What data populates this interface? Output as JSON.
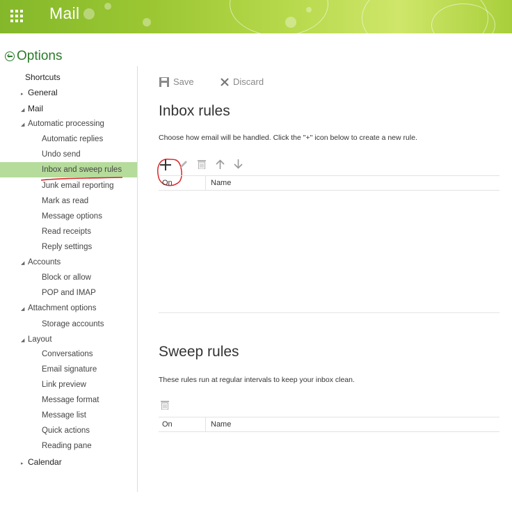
{
  "header": {
    "app_title": "Mail",
    "waffle_icon": "app-launcher-icon",
    "accent_color": "#8fbf2f"
  },
  "options": {
    "title": "Options",
    "back_icon": "back-arrow-circle-icon",
    "title_color": "#2a7a2a"
  },
  "nav": {
    "selected_color": "#b6dc9c",
    "items": [
      {
        "label": "Shortcuts",
        "type": "section",
        "arrow": ""
      },
      {
        "label": "General",
        "type": "section",
        "arrow": "collapsed"
      },
      {
        "label": "Mail",
        "type": "section",
        "arrow": "expanded"
      },
      {
        "label": "Automatic processing",
        "type": "group",
        "arrow": "expanded"
      },
      {
        "label": "Automatic replies",
        "type": "item"
      },
      {
        "label": "Undo send",
        "type": "item"
      },
      {
        "label": "Inbox and sweep rules",
        "type": "item",
        "selected": true
      },
      {
        "label": "Junk email reporting",
        "type": "item"
      },
      {
        "label": "Mark as read",
        "type": "item"
      },
      {
        "label": "Message options",
        "type": "item"
      },
      {
        "label": "Read receipts",
        "type": "item"
      },
      {
        "label": "Reply settings",
        "type": "item"
      },
      {
        "label": "Accounts",
        "type": "group",
        "arrow": "expanded"
      },
      {
        "label": "Block or allow",
        "type": "item"
      },
      {
        "label": "POP and IMAP",
        "type": "item"
      },
      {
        "label": "Attachment options",
        "type": "group",
        "arrow": "expanded"
      },
      {
        "label": "Storage accounts",
        "type": "item"
      },
      {
        "label": "Layout",
        "type": "group",
        "arrow": "expanded"
      },
      {
        "label": "Conversations",
        "type": "item"
      },
      {
        "label": "Email signature",
        "type": "item"
      },
      {
        "label": "Link preview",
        "type": "item"
      },
      {
        "label": "Message format",
        "type": "item"
      },
      {
        "label": "Message list",
        "type": "item"
      },
      {
        "label": "Quick actions",
        "type": "item"
      },
      {
        "label": "Reading pane",
        "type": "item"
      },
      {
        "label": "Calendar",
        "type": "section",
        "arrow": "collapsed"
      }
    ]
  },
  "toolbar": {
    "save_label": "Save",
    "save_icon": "save-disk-icon",
    "discard_label": "Discard",
    "discard_icon": "close-x-icon"
  },
  "inbox_rules": {
    "title": "Inbox rules",
    "description": "Choose how email will be handled. Click the \"+\" icon below to create a new rule.",
    "actions": [
      "add-icon",
      "edit-pencil-icon",
      "delete-trash-icon",
      "move-up-arrow-icon",
      "move-down-arrow-icon"
    ],
    "columns": [
      "On",
      "Name"
    ]
  },
  "sweep_rules": {
    "title": "Sweep rules",
    "description": "These rules run at regular intervals to keep your inbox clean.",
    "actions": [
      "delete-trash-icon"
    ],
    "columns": [
      "On",
      "Name"
    ]
  },
  "annotation_color": "#d8262a"
}
